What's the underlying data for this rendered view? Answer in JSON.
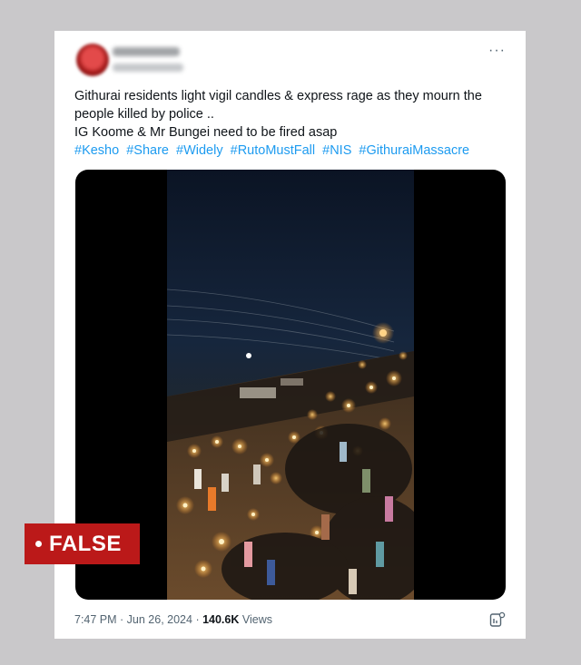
{
  "tweet": {
    "lines": [
      "Githurai residents light vigil candles & express rage as they mourn the",
      "people killed by police ..",
      "IG Koome & Mr Bungei need to be fired asap"
    ],
    "hashtags": [
      "#Kesho",
      "#Share",
      "#Widely",
      "#RutoMustFall",
      "#NIS",
      "#GithuraiMassacre"
    ],
    "more_label": "···"
  },
  "meta": {
    "time": "7:47 PM",
    "date": "Jun 26, 2024",
    "separator": " · ",
    "views_count": "140.6K",
    "views_label": "Views"
  },
  "badge": {
    "label": "FALSE",
    "color": "#bb1919"
  },
  "colors": {
    "hashtag": "#1d9bf0",
    "background": "#c9c8ca",
    "card": "#ffffff"
  },
  "icons": {
    "more": "more-horizontal-icon",
    "analytics": "analytics-icon"
  }
}
